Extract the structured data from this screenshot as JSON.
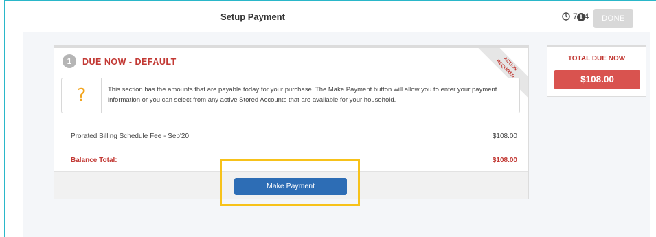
{
  "header": {
    "title": "Setup Payment",
    "timer": "7:04",
    "timer_icon": "clock-icon",
    "info_icon": "info-icon",
    "done_label": "DONE"
  },
  "due_card": {
    "step_number": "1",
    "title": "DUE NOW - DEFAULT",
    "ribbon_line1": "ACTION",
    "ribbon_line2": "REQUIRED",
    "info_icon": "question-mark-icon",
    "info_symbol": "?",
    "info_text": "This section has the amounts that are payable today for your purchase. The Make Payment button will allow you to enter your payment information or you can select from any active Stored Accounts that are available for your household.",
    "line_items": [
      {
        "label": "Prorated Billing Schedule Fee - Sep'20",
        "amount": "$108.00"
      }
    ],
    "balance": {
      "label": "Balance Total:",
      "amount": "$108.00"
    },
    "pay_button_label": "Make Payment"
  },
  "summary": {
    "title": "TOTAL DUE NOW",
    "total": "$108.00"
  },
  "colors": {
    "accent_red": "#c23934",
    "total_red": "#d9534f",
    "primary_blue": "#2d6db5",
    "highlight_yellow": "#f7c21a",
    "frame_teal": "#2ab7c9"
  }
}
